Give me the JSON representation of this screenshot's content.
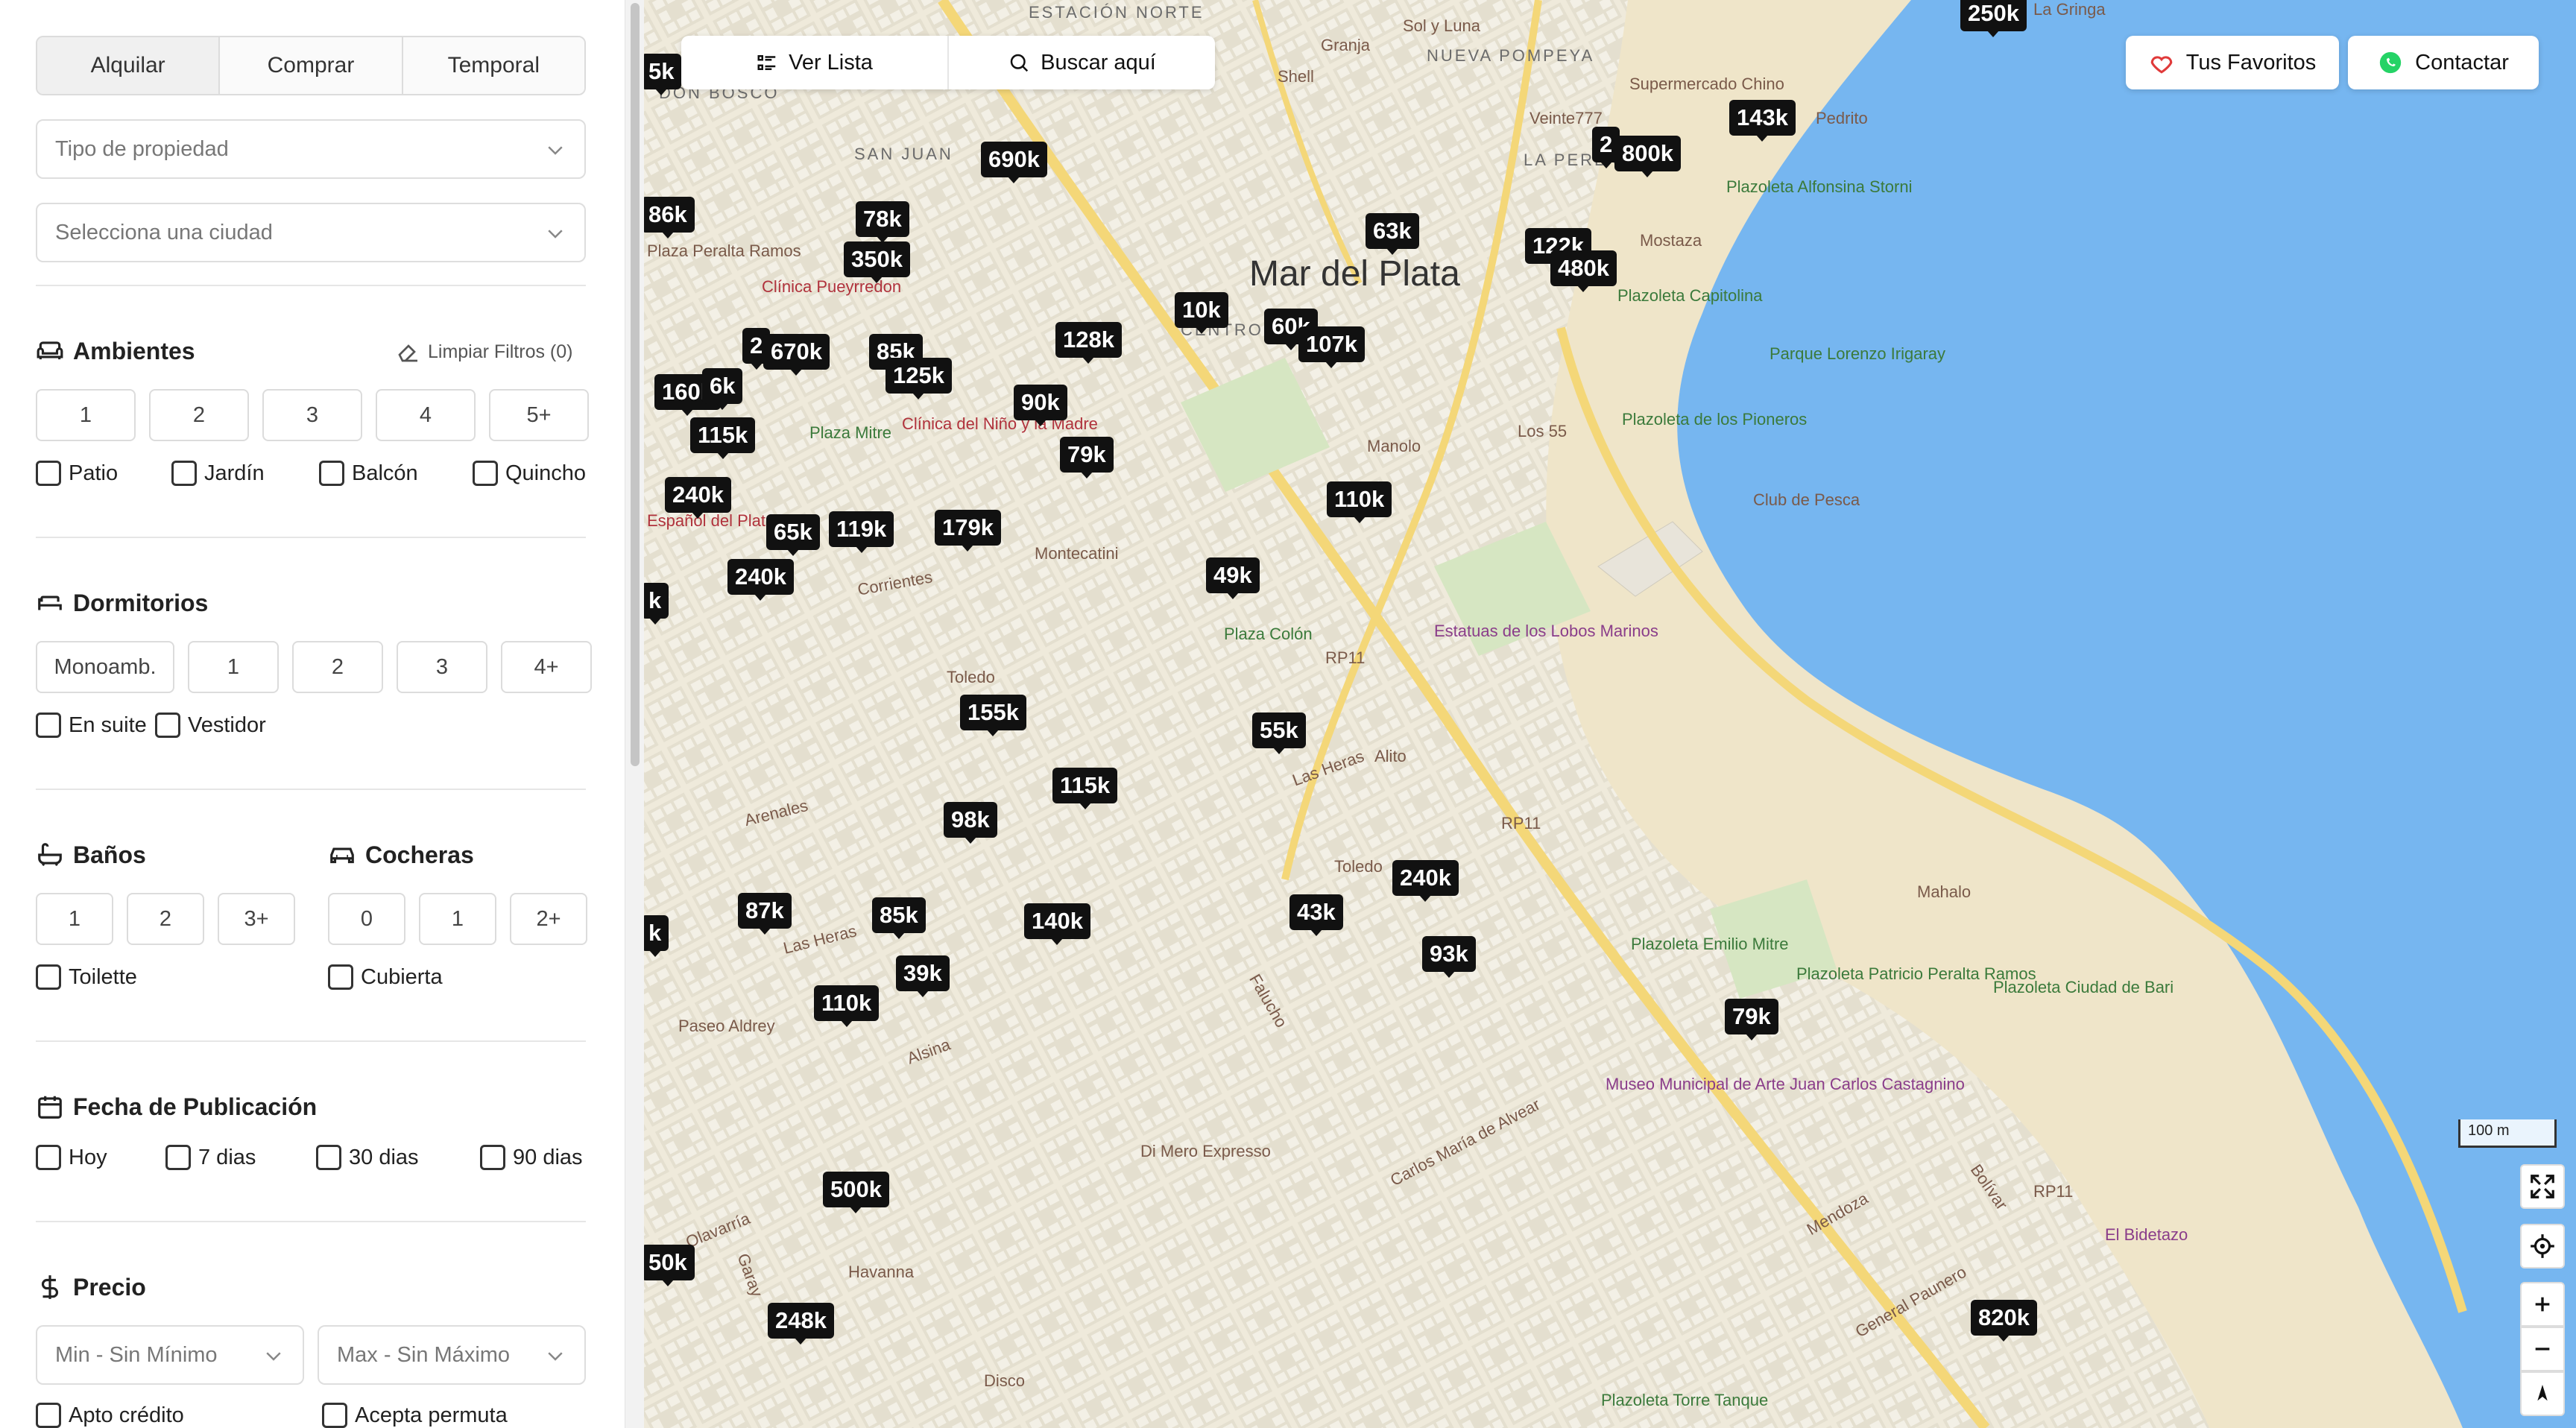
{
  "sidebar": {
    "operation_tabs": [
      "Alquilar",
      "Comprar",
      "Temporal"
    ],
    "property_type_placeholder": "Tipo de propiedad",
    "city_placeholder": "Selecciona una ciudad",
    "clear_filters": "Limpiar Filtros (0)",
    "ambientes": {
      "title": "Ambientes",
      "options": [
        "1",
        "2",
        "3",
        "4",
        "5+"
      ],
      "features": [
        "Patio",
        "Jardín",
        "Balcón",
        "Quincho"
      ]
    },
    "dormitorios": {
      "title": "Dormitorios",
      "options": [
        "Monoamb.",
        "1",
        "2",
        "3",
        "4+"
      ],
      "features": [
        "En suite",
        "Vestidor"
      ]
    },
    "banos": {
      "title": "Baños",
      "options": [
        "1",
        "2",
        "3+"
      ],
      "features": [
        "Toilette"
      ]
    },
    "cocheras": {
      "title": "Cocheras",
      "options": [
        "0",
        "1",
        "2+"
      ],
      "features": [
        "Cubierta"
      ]
    },
    "fecha": {
      "title": "Fecha de Publicación",
      "options": [
        "Hoy",
        "7 dias",
        "30 dias",
        "90 dias"
      ]
    },
    "precio": {
      "title": "Precio",
      "min_placeholder": "Min - Sin Mínimo",
      "max_placeholder": "Max - Sin Máximo",
      "extras": [
        "Apto crédito",
        "Acepta permuta"
      ]
    }
  },
  "map": {
    "ver_lista": "Ver Lista",
    "buscar_aqui": "Buscar aquí",
    "favoritos": "Tus Favoritos",
    "contactar": "Contactar",
    "scale_label": "100 m",
    "colors": {
      "water": "#76b6f0",
      "land": "#efeadb",
      "beach": "#efe5c9",
      "road_major": "#f4d778",
      "marker": "#111111"
    },
    "prices": [
      "5k",
      "250k",
      "690k",
      "143k",
      "2",
      "800k",
      "86k",
      "78k",
      "350k",
      "63k",
      "122k",
      "480k",
      "10k",
      "60k",
      "107k",
      "2",
      "670k",
      "85k",
      "125k",
      "128k",
      "160k",
      "6k",
      "90k",
      "115k",
      "79k",
      "240k",
      "110k",
      "65k",
      "119k",
      "179k",
      "240k",
      "k",
      "49k",
      "155k",
      "55k",
      "115k",
      "98k",
      "240k",
      "87k",
      "85k",
      "140k",
      "43k",
      "93k",
      "39k",
      "110k",
      "79k",
      "k",
      "500k",
      "50k",
      "248k",
      "820k"
    ],
    "labels": {
      "city": "Mar del Plata",
      "estacion_norte": "ESTACIÓN NORTE",
      "nueva_pompeya": "NUEVA POMPEYA",
      "don_bosco": "DON BOSCO",
      "san_juan": "SAN JUAN",
      "la_perla": "LA PERLA",
      "centro": "CENTRO",
      "granja": "Granja",
      "sol_y_luna": "Sol y Luna",
      "shell": "Shell",
      "supermercado_chino": "Supermercado Chino",
      "veinte777": "Veinte777",
      "pedrito": "Pedrito",
      "la_gringa": "La Gringa",
      "plazoleta_alfonsina": "Plazoleta Alfonsina Storni",
      "mostaza": "Mostaza",
      "plazoleta_capitolina": "Plazoleta Capitolina",
      "parque_lorenzo": "Parque Lorenzo Irigaray",
      "los_55": "Los 55",
      "plazoleta_pioneros": "Plazoleta de los Pioneros",
      "club_pesca": "Club de Pesca",
      "clinica_pueyrredon": "Clínica Pueyrredon",
      "plaza_peralta": "Plaza Peralta Ramos",
      "plaza_mitre": "Plaza Mitre",
      "clinica_nino": "Clínica del Niño y la Madre",
      "manolo": "Manolo",
      "espanol": "Español del Plata",
      "montecatini": "Montecatini",
      "plaza_colon": "Plaza Colón",
      "estatuas": "Estatuas de los Lobos Marinos",
      "rp11_a": "RP11",
      "rp11_b": "RP11",
      "rp11_c": "RP11",
      "toledo_a": "Toledo",
      "toledo_b": "Toledo",
      "alito": "Alito",
      "mahalo": "Mahalo",
      "plazoleta_emilio": "Plazoleta Emilio Mitre",
      "plazoleta_patricio": "Plazoleta Patricio Peralta Ramos",
      "plazoleta_bari": "Plazoleta Ciudad de Bari",
      "paseo_aldrey": "Paseo Aldrey",
      "museo": "Museo Municipal de Arte Juan Carlos Castagnino",
      "di_mero": "Di Mero Expresso",
      "havanna": "Havanna",
      "disco": "Disco",
      "el_bidetazo": "El Bidetazo",
      "plazoleta_torre": "Plazoleta Torre Tanque",
      "street_corrientes": "Corrientes",
      "street_arenales": "Arenales",
      "street_las_heras_a": "Las Heras",
      "street_las_heras_b": "Las Heras",
      "street_alsina": "Alsina",
      "street_falucho": "Falucho",
      "street_olavarria": "Olavarría",
      "street_garay": "Garay",
      "street_carlos_alvear": "Carlos María de Alvear",
      "street_mendoza": "Mendoza",
      "street_bolivar": "Bolívar",
      "street_paunero": "General Paunero"
    }
  }
}
